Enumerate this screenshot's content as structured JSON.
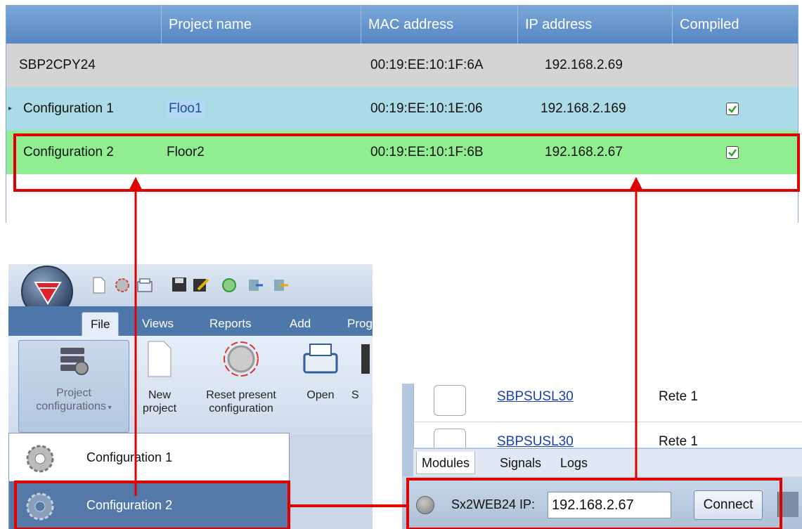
{
  "grid": {
    "headers": [
      "",
      "Project name",
      "MAC address",
      "IP address",
      "Compiled"
    ],
    "rows": [
      {
        "config": "SBP2CPY24",
        "project": "",
        "mac": "00:19:EE:10:1F:6A",
        "ip": "192.168.2.69",
        "compiled": false,
        "state": "default"
      },
      {
        "config": "Configuration 1",
        "project": "Floo1",
        "mac": "00:19:EE:10:1E:06",
        "ip": "192.168.2.169",
        "compiled": true,
        "state": "current"
      },
      {
        "config": "Configuration 2",
        "project": "Floor2",
        "mac": "00:19:EE:10:1F:6B",
        "ip": "192.168.2.67",
        "compiled": true,
        "state": "highlighted"
      }
    ]
  },
  "app": {
    "tabs": [
      "File",
      "Views",
      "Reports",
      "Add",
      "Prog"
    ],
    "active_tab": "File",
    "ribbon": {
      "project_configurations_line1": "Project",
      "project_configurations_line2": "configurations",
      "new_line1": "New",
      "new_line2": "project",
      "reset_line1": "Reset present",
      "reset_line2": "configuration",
      "open": "Open",
      "save_partial": "S"
    },
    "dropdown": {
      "items": [
        "Configuration 1",
        "Configuration 2"
      ],
      "selected": "Configuration 2"
    }
  },
  "modules": {
    "rows": [
      {
        "name": "SBPSUSL30",
        "network": "Rete 1"
      },
      {
        "name": "SBPSUSL30",
        "network": "Rete 1"
      }
    ],
    "tabs": [
      "Modules",
      "Signals",
      "Logs"
    ],
    "active_tab": "Modules",
    "ip_label": "Sx2WEB24 IP:",
    "ip_value": "192.168.2.67",
    "connect_label": "Connect"
  },
  "colors": {
    "header": "#5f8fcb",
    "row_default": "#d4d4d4",
    "row_current": "#aadbe6",
    "row_highlight": "#90ee90",
    "annotation": "#e00000",
    "dropdown_selected": "#5479a8"
  }
}
